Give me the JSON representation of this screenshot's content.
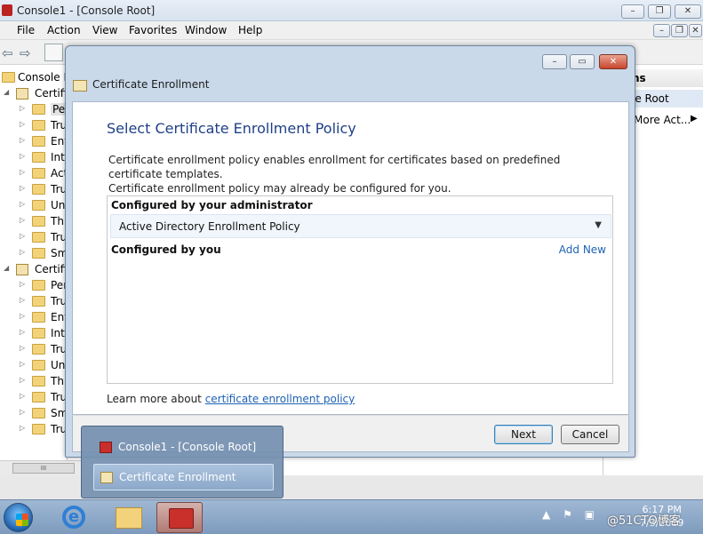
{
  "mmc": {
    "title": "Console1 - [Console Root]",
    "menu": [
      "File",
      "Action",
      "View",
      "Favorites",
      "Window",
      "Help"
    ],
    "tree": [
      {
        "label": "Console R",
        "indent": 0,
        "icon": "folder"
      },
      {
        "label": "Certifi",
        "indent": 1,
        "icon": "cert"
      },
      {
        "label": "Per",
        "indent": 2,
        "icon": "folder",
        "selected": true
      },
      {
        "label": "Tru",
        "indent": 2,
        "icon": "folder"
      },
      {
        "label": "Ent",
        "indent": 2,
        "icon": "folder"
      },
      {
        "label": "Int",
        "indent": 2,
        "icon": "folder"
      },
      {
        "label": "Act",
        "indent": 2,
        "icon": "folder"
      },
      {
        "label": "Tru",
        "indent": 2,
        "icon": "folder"
      },
      {
        "label": "Un",
        "indent": 2,
        "icon": "folder"
      },
      {
        "label": "Thi",
        "indent": 2,
        "icon": "folder"
      },
      {
        "label": "Tru",
        "indent": 2,
        "icon": "folder"
      },
      {
        "label": "Sm",
        "indent": 2,
        "icon": "folder"
      },
      {
        "label": "Certifi",
        "indent": 1,
        "icon": "cert"
      },
      {
        "label": "Per",
        "indent": 2,
        "icon": "folder"
      },
      {
        "label": "Tru",
        "indent": 2,
        "icon": "folder"
      },
      {
        "label": "Ent",
        "indent": 2,
        "icon": "folder"
      },
      {
        "label": "Int",
        "indent": 2,
        "icon": "folder"
      },
      {
        "label": "Tru",
        "indent": 2,
        "icon": "folder"
      },
      {
        "label": "Un",
        "indent": 2,
        "icon": "folder"
      },
      {
        "label": "Thi",
        "indent": 2,
        "icon": "folder"
      },
      {
        "label": "Tru",
        "indent": 2,
        "icon": "folder"
      },
      {
        "label": "Sm",
        "indent": 2,
        "icon": "folder"
      },
      {
        "label": "Tru",
        "indent": 2,
        "icon": "folder"
      }
    ],
    "actions": {
      "header": "ns",
      "sub": "le Root",
      "more": "More Act..."
    }
  },
  "dialog": {
    "title": "Certificate Enrollment",
    "heading": "Select Certificate Enrollment Policy",
    "description_line1": "Certificate enrollment policy enables enrollment for certificates based on predefined certificate templates.",
    "description_line2": "Certificate enrollment policy may already be configured for you.",
    "admin_section": "Configured by your administrator",
    "policy_item": "Active Directory Enrollment Policy",
    "user_section": "Configured by you",
    "add_new": "Add New",
    "learn_prefix": "Learn more about ",
    "learn_link": "certificate enrollment policy",
    "next_button": "Next",
    "cancel_button": "Cancel"
  },
  "taskbar_popup": {
    "items": [
      "Console1 - [Console Root]",
      "Certificate Enrollment"
    ],
    "highlighted_index": 1
  },
  "taskbar": {
    "clock_time": "6:17 PM",
    "clock_date": "7/3/2019",
    "watermark": "@51CTO博客"
  },
  "colors": {
    "heading": "#1f3f86",
    "link": "#1f62b3",
    "taskbar": "#8ea8c7"
  }
}
